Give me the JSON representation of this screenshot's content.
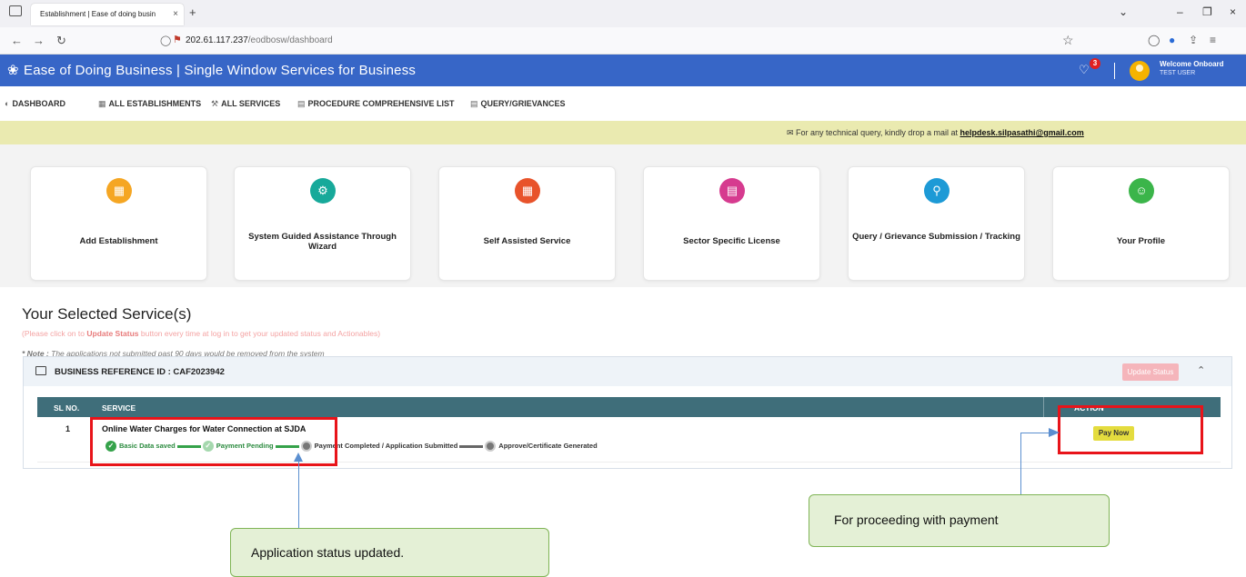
{
  "browser": {
    "tab_title": "Establishment | Ease of doing busin",
    "tab_close": "×",
    "new_tab": "+",
    "url_host": "202.61.117.237",
    "url_path": "/eodbosw/dashboard"
  },
  "header": {
    "title": "Ease of Doing Business | Single Window Services for Business",
    "notification_count": "3",
    "welcome": "Welcome Onboard",
    "user": "TEST USER"
  },
  "menu": [
    {
      "label": "DASHBOARD",
      "icon": "dashboard-icon"
    },
    {
      "label": "ALL ESTABLISHMENTS",
      "icon": "building-icon"
    },
    {
      "label": "ALL SERVICES",
      "icon": "wrench-icon"
    },
    {
      "label": "PROCEDURE COMPREHENSIVE LIST",
      "icon": "list-icon"
    },
    {
      "label": "QUERY/GRIEVANCES",
      "icon": "list-icon"
    }
  ],
  "notice": {
    "text": "For any technical query, kindly drop a mail at",
    "mail": "helpdesk.silpasathi@gmail.com"
  },
  "cards": [
    {
      "label": "Add Establishment",
      "color": "#f5a623",
      "icon": "building-icon"
    },
    {
      "label": "System Guided Assistance Through Wizard",
      "color": "#17a99a",
      "icon": "gear-icon"
    },
    {
      "label": "Self Assisted Service",
      "color": "#e8532b",
      "icon": "apps-icon"
    },
    {
      "label": "Sector Specific License",
      "color": "#d63b8f",
      "icon": "license-icon"
    },
    {
      "label": "Query / Grievance Submission / Tracking",
      "color": "#1d9ad6",
      "icon": "search-icon"
    },
    {
      "label": "Your Profile",
      "color": "#3bb54a",
      "icon": "profile-icon"
    }
  ],
  "selected": {
    "title": "Your Selected Service(s)",
    "hint_pre": "(Please click on to",
    "hint_bold": "Update Status",
    "hint_post": "button every time at log in to get your updated status and Actionables)",
    "note_label": "* Note :",
    "note_text": "The applications not submitted past 90 days would be removed from the system",
    "ref_label": "BUSINESS REFERENCE ID :",
    "ref_id": "CAF2023942",
    "update_btn": "Update Status",
    "columns": {
      "sl": "SL NO.",
      "service": "SERVICE",
      "action": "ACTION"
    },
    "row": {
      "sl": "1",
      "service": "Online Water Charges for Water Connection at SJDA",
      "steps": [
        "Basic Data saved",
        "Payment Pending",
        "Payment Completed / Application Submitted",
        "Approve/Certificate Generated"
      ],
      "action": "Pay Now"
    }
  },
  "annotations": {
    "status": "Application status updated.",
    "payment": "For proceeding with payment"
  }
}
